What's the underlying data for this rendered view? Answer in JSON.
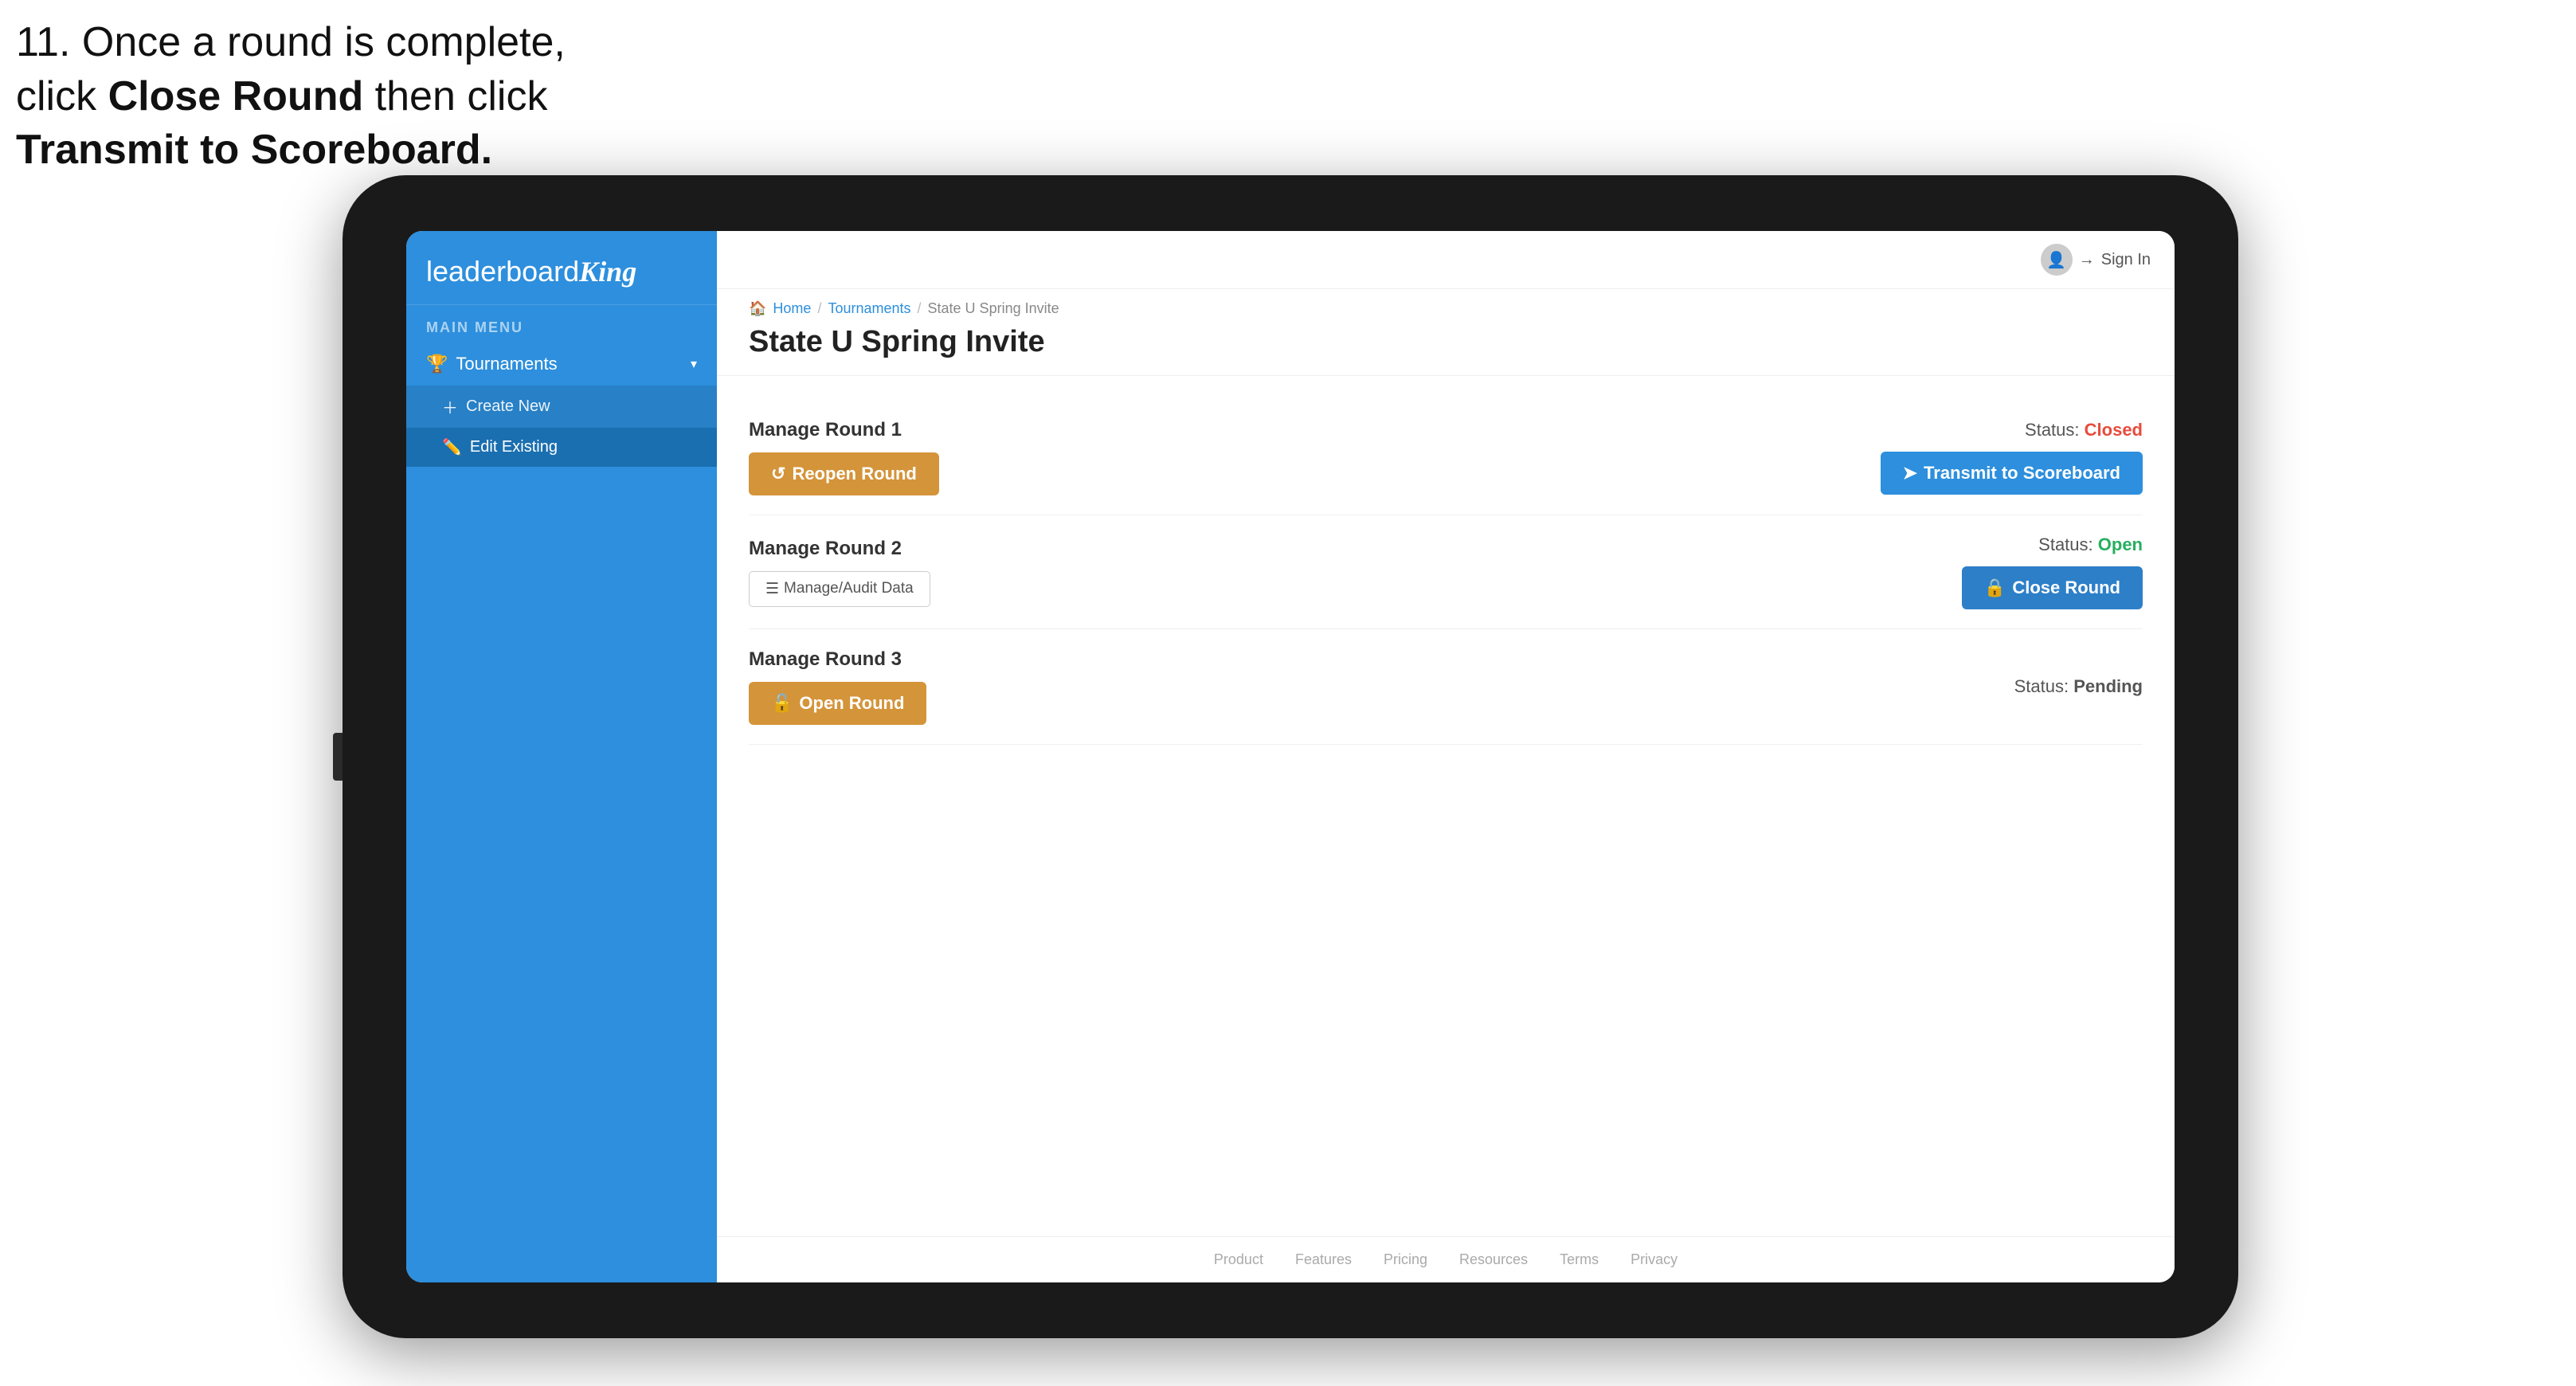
{
  "instruction": {
    "line1": "11. Once a round is complete,",
    "line2": "click ",
    "line2_bold": "Close Round",
    "line2_end": " then click",
    "line3": "Transmit to Scoreboard."
  },
  "breadcrumb": {
    "home": "Home",
    "separator1": "/",
    "tournaments": "Tournaments",
    "separator2": "/",
    "current": "State U Spring Invite"
  },
  "page_title": "State U Spring Invite",
  "header": {
    "sign_in": "Sign In"
  },
  "sidebar": {
    "menu_label": "MAIN MENU",
    "tournaments_label": "Tournaments",
    "create_new": "Create New",
    "edit_existing": "Edit Existing"
  },
  "rounds": [
    {
      "manage_label": "Manage Round 1",
      "status_label": "Status:",
      "status_value": "Closed",
      "status_type": "closed",
      "primary_btn": "Reopen Round",
      "secondary_btn": "Transmit to Scoreboard"
    },
    {
      "manage_label": "Manage Round 2",
      "status_label": "Status:",
      "status_value": "Open",
      "status_type": "open",
      "primary_btn": "Manage/Audit Data",
      "secondary_btn": "Close Round"
    },
    {
      "manage_label": "Manage Round 3",
      "status_label": "Status:",
      "status_value": "Pending",
      "status_type": "pending",
      "primary_btn": "Open Round",
      "secondary_btn": null
    }
  ],
  "footer": {
    "links": [
      "Product",
      "Features",
      "Pricing",
      "Resources",
      "Terms",
      "Privacy"
    ]
  },
  "logo": {
    "prefix": "leaderboard",
    "brand": "King"
  }
}
